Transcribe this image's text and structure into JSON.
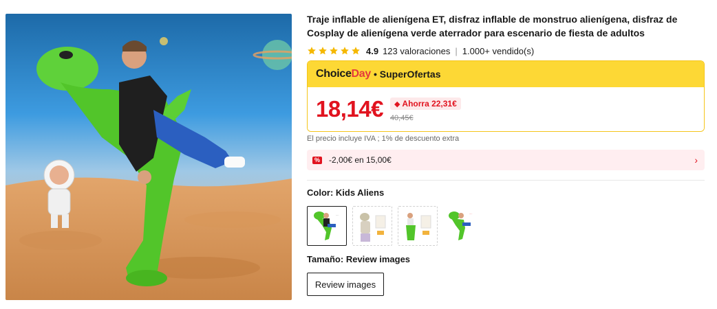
{
  "product": {
    "title": "Traje inflable de alienígena ET, disfraz inflable de monstruo alienígena, disfraz de Cosplay de alienígena verde aterrador para escenario de fiesta de adultos",
    "rating": "4.9",
    "reviews": "123 valoraciones",
    "separator": "|",
    "sold": "1.000+ vendido(s)"
  },
  "choice": {
    "brand_part1": "Choice",
    "brand_part2": "Day",
    "tagline": "• SuperOfertas",
    "price": "18,14€",
    "save": "Ahorra 22,31€",
    "old_price": "40,45€"
  },
  "vat_note": "El precio incluye IVA ; 1% de descuento extra",
  "coupon": {
    "icon_label": "%",
    "text": "-2,00€ en 15,00€"
  },
  "color": {
    "label": "Color: Kids Aliens",
    "options": [
      {
        "name": "Kids Aliens",
        "selected": true
      },
      {
        "name": "option-2",
        "selected": false
      },
      {
        "name": "option-3",
        "selected": false
      },
      {
        "name": "option-4",
        "selected": false
      }
    ]
  },
  "size": {
    "label": "Tamaño: Review images",
    "options": [
      "Review images"
    ]
  },
  "colors": {
    "price_red": "#e1131f",
    "choice_yellow": "#fdd835",
    "coupon_bg": "#ffeef0",
    "star_yellow": "#f5b800"
  }
}
